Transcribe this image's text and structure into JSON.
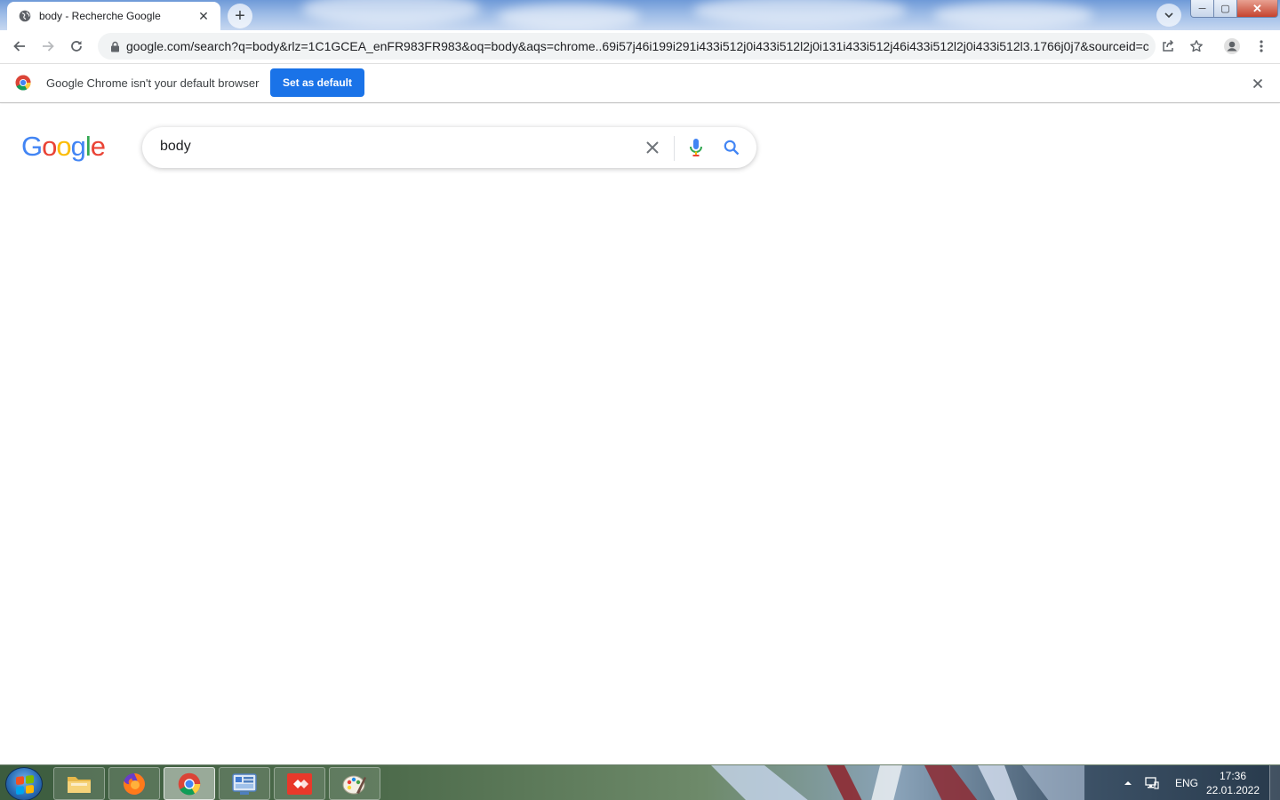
{
  "browser": {
    "tab": {
      "title": "body - Recherche Google",
      "close_symbol": "✕"
    },
    "new_tab_symbol": "+",
    "url": "google.com/search?q=body&rlz=1C1GCEA_enFR983FR983&oq=body&aqs=chrome..69i57j46i199i291i433i512j0i433i512l2j0i131i433i512j46i433i512l2j0i433i512l3.1766j0j7&sourceid=c...",
    "window_controls": {
      "minimize": "─",
      "maximize": "▢",
      "close": "✕"
    }
  },
  "infobar": {
    "message": "Google Chrome isn't your default browser",
    "button_label": "Set as default",
    "close_symbol": "✕"
  },
  "search": {
    "logo_letters": [
      {
        "char": "G",
        "color": "#4285f4"
      },
      {
        "char": "o",
        "color": "#ea4335"
      },
      {
        "char": "o",
        "color": "#fbbc05"
      },
      {
        "char": "g",
        "color": "#4285f4"
      },
      {
        "char": "l",
        "color": "#34a853"
      },
      {
        "char": "e",
        "color": "#ea4335"
      }
    ],
    "query": "body"
  },
  "taskbar": {
    "apps": [
      "file-explorer",
      "firefox",
      "chrome",
      "control-panel",
      "anydesk",
      "paint"
    ],
    "active_app": "chrome",
    "language": "ENG",
    "time": "17:36",
    "date": "22.01.2022"
  },
  "colors": {
    "accent_blue": "#1a73e8",
    "google_blue": "#4285f4",
    "google_red": "#ea4335",
    "google_yellow": "#fbbc05",
    "google_green": "#34a853"
  }
}
